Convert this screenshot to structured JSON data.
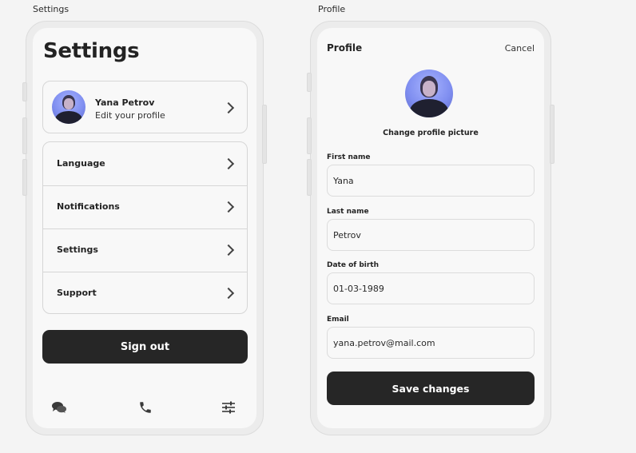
{
  "frames": {
    "settings_label": "Settings",
    "profile_label": "Profile"
  },
  "settings": {
    "title": "Settings",
    "profile": {
      "name": "Yana Petrov",
      "subtitle": "Edit your profile",
      "avatar": "user-avatar-photo"
    },
    "menu": [
      {
        "label": "Language"
      },
      {
        "label": "Notifications"
      },
      {
        "label": "Settings"
      },
      {
        "label": "Support"
      }
    ],
    "sign_out": "Sign out",
    "bottom_nav": [
      "chat-bubbles-icon",
      "phone-icon",
      "sliders-icon"
    ]
  },
  "profile_form": {
    "title": "Profile",
    "cancel": "Cancel",
    "change_picture": "Change profile picture",
    "fields": {
      "first_name": {
        "label": "First name",
        "value": "Yana"
      },
      "last_name": {
        "label": "Last name",
        "value": "Petrov"
      },
      "dob": {
        "label": "Date of birth",
        "value": "01-03-1989"
      },
      "email": {
        "label": "Email",
        "value": "yana.petrov@mail.com"
      }
    },
    "save": "Save changes"
  },
  "colors": {
    "button_bg": "#262626",
    "screen_bg": "#f8f8f8",
    "avatar_bg": "#8b98f5"
  }
}
